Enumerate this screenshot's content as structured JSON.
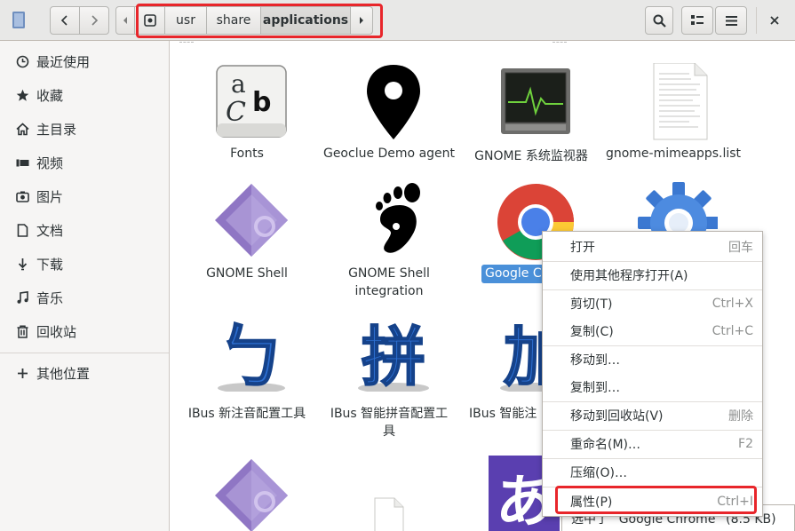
{
  "path": {
    "crumbs": [
      "usr",
      "share",
      "applications"
    ],
    "active": "applications"
  },
  "sidebar": {
    "items": [
      {
        "label": "最近使用",
        "icon": "clock-icon"
      },
      {
        "label": "收藏",
        "icon": "star-icon"
      },
      {
        "label": "主目录",
        "icon": "home-icon"
      },
      {
        "label": "视频",
        "icon": "video-icon"
      },
      {
        "label": "图片",
        "icon": "camera-icon"
      },
      {
        "label": "文档",
        "icon": "document-icon"
      },
      {
        "label": "下载",
        "icon": "download-icon"
      },
      {
        "label": "音乐",
        "icon": "music-icon"
      },
      {
        "label": "回收站",
        "icon": "trash-icon"
      }
    ],
    "other": {
      "label": "其他位置",
      "icon": "plus-icon"
    }
  },
  "files": [
    {
      "name": "Fonts",
      "icon": "fonts-icon"
    },
    {
      "name": "Geoclue Demo agent",
      "icon": "map-pin-icon"
    },
    {
      "name": "GNOME 系统监视器",
      "icon": "system-monitor-icon"
    },
    {
      "name": "gnome-mimeapps.list",
      "icon": "text-file-icon"
    },
    {
      "name": "GNOME Shell",
      "icon": "gnome-shell-icon"
    },
    {
      "name_line1": "GNOME Shell",
      "name_line2": "integration",
      "icon": "gnome-foot-icon"
    },
    {
      "name": "Google Ch",
      "icon": "chrome-icon",
      "selected": true
    },
    {
      "name": "",
      "icon": "gear-settings-icon"
    },
    {
      "name": "IBus 新注音配置工具",
      "icon": "bopomofo-icon",
      "glyph": "ㄅ"
    },
    {
      "name_line1": "IBus 智能拼音配置工",
      "name_line2": "具",
      "icon": "pinyin-icon",
      "glyph": "拼"
    },
    {
      "name_line1": "IBus 智能注",
      "name_line2": "具",
      "icon": "ibus-icon",
      "glyph": "加"
    },
    {
      "name": "",
      "icon": "gnome-shell-icon"
    },
    {
      "name": "",
      "icon": "text-file-icon"
    },
    {
      "name": "",
      "icon": "kana-icon",
      "glyph": "あ"
    }
  ],
  "context_menu": {
    "items": [
      {
        "label": "打开",
        "accel": "回车"
      },
      {
        "label": "使用其他程序打开(A)",
        "accel": ""
      },
      {
        "label": "剪切(T)",
        "accel": "Ctrl+X"
      },
      {
        "label": "复制(C)",
        "accel": "Ctrl+C"
      },
      {
        "label": "移动到…",
        "accel": ""
      },
      {
        "label": "复制到…",
        "accel": ""
      },
      {
        "label": "移动到回收站(V)",
        "accel": "删除"
      },
      {
        "label": "重命名(M)…",
        "accel": "F2"
      },
      {
        "label": "压缩(O)…",
        "accel": ""
      },
      {
        "label": "属性(P)",
        "accel": "Ctrl+I"
      }
    ]
  },
  "status": {
    "text": "选中了 “Google Chrome” (8.5 KB)"
  },
  "colors": {
    "accent": "#4a90d9",
    "highlight_frame": "#e8262b"
  }
}
